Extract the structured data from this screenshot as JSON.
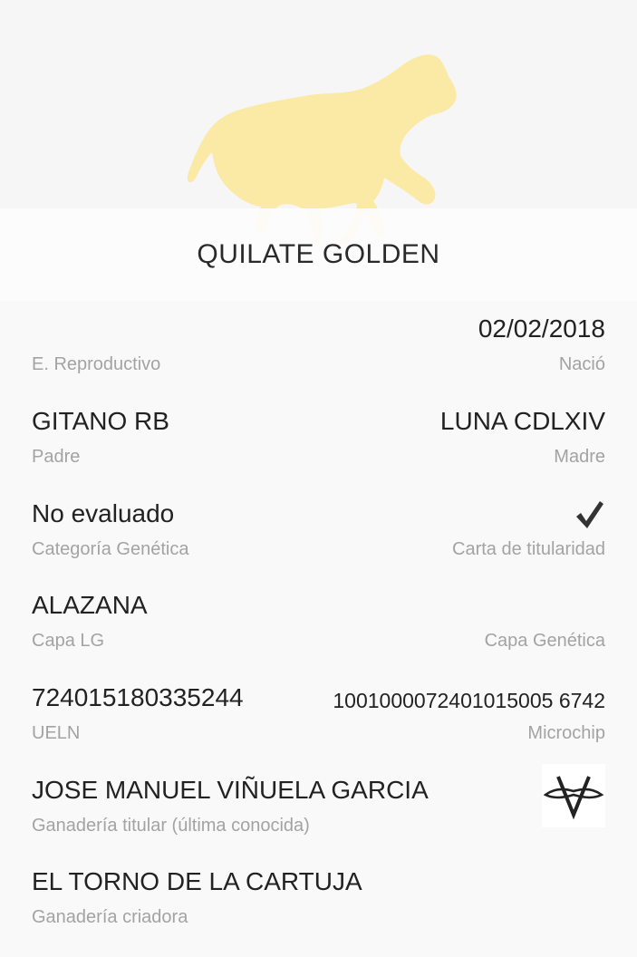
{
  "header": {
    "horse_name": "QUILATE GOLDEN",
    "hero_icon": "horse-silhouette",
    "hero_color": "#fbe9a6"
  },
  "fields": {
    "estado": {
      "value": "",
      "label": "E. Reproductivo"
    },
    "nacio": {
      "value": "02/02/2018",
      "label": "Nació"
    },
    "padre": {
      "value": "GITANO RB",
      "label": "Padre"
    },
    "madre": {
      "value": "LUNA CDLXIV",
      "label": "Madre"
    },
    "categoria": {
      "value": "No evaluado",
      "label": "Categoría Genética"
    },
    "carta": {
      "icon": "check-icon",
      "label": "Carta de titularidad"
    },
    "capa_lg": {
      "value": "ALAZANA",
      "label": "Capa LG"
    },
    "capa_genetica": {
      "value": "",
      "label": "Capa Genética"
    },
    "ueln": {
      "value": "724015180335244",
      "label": "UELN"
    },
    "microchip": {
      "value": "1001000072401015005 6742",
      "label": "Microchip"
    },
    "ganaderia_titular": {
      "value": "JOSE MANUEL VIÑUELA GARCIA",
      "label": "Ganadería titular (última conocida)",
      "logo_icon": "brand-mark-icon"
    },
    "ganaderia_criadora": {
      "value": "EL TORNO DE LA CARTUJA",
      "label": "Ganadería criadora"
    }
  }
}
